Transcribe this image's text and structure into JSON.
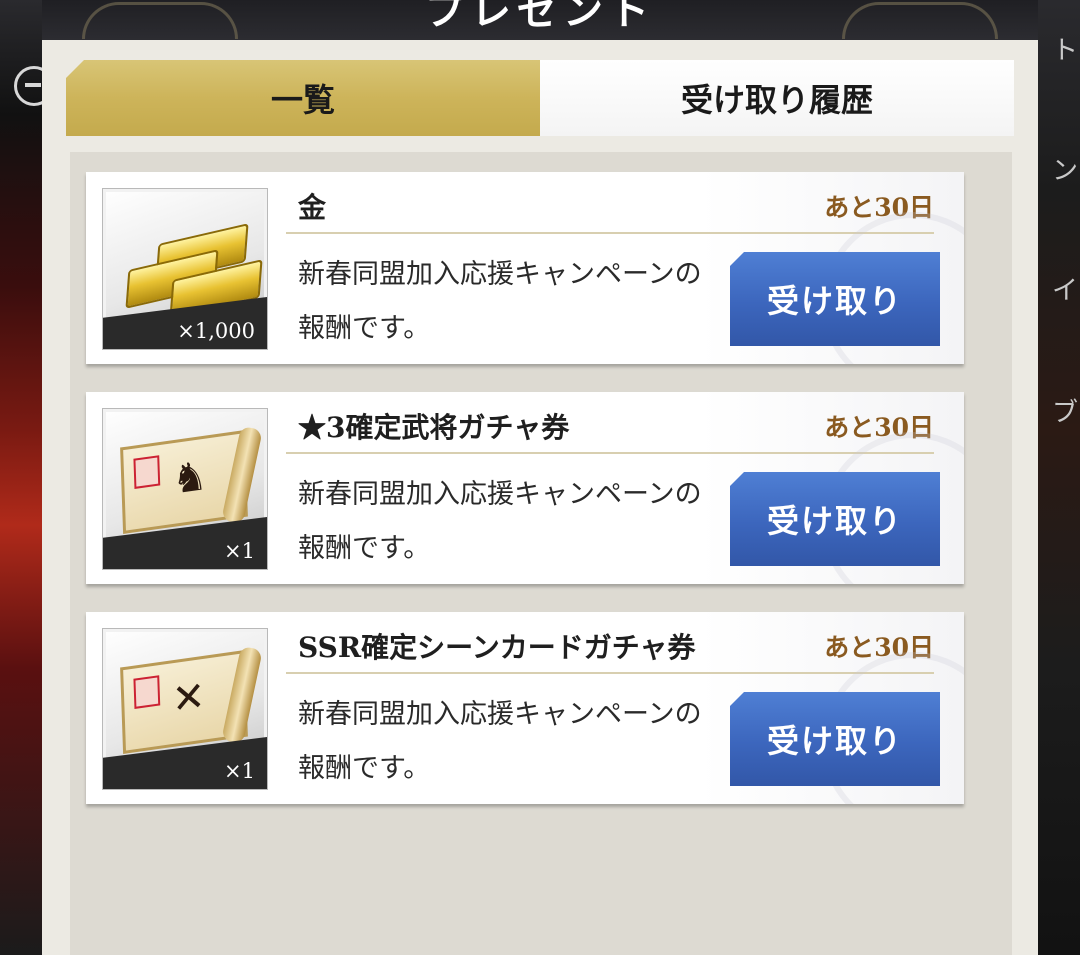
{
  "header": {
    "title": "プレゼント"
  },
  "side": {
    "label_1": "ト",
    "label_2": "ン",
    "label_3": "イ",
    "label_4": "ブ"
  },
  "tabs": [
    {
      "label": "一覧",
      "active": true
    },
    {
      "label": "受け取り履歴",
      "active": false
    }
  ],
  "items": [
    {
      "name": "金",
      "remaining": "あと30日",
      "description": "新春同盟加入応援キャンペーンの報酬です。",
      "quantity": "×1,000",
      "icon": "gold-bars-icon",
      "button": "受け取り"
    },
    {
      "name": "★3確定武将ガチャ券",
      "remaining": "あと30日",
      "description": "新春同盟加入応援キャンペーンの報酬です。",
      "quantity": "×1",
      "icon": "general-gacha-ticket-icon",
      "button": "受け取り"
    },
    {
      "name": "SSR確定シーンカードガチャ券",
      "remaining": "あと30日",
      "description": "新春同盟加入応援キャンペーンの報酬です。",
      "quantity": "×1",
      "icon": "scene-card-gacha-ticket-icon",
      "button": "受け取り"
    }
  ],
  "colors": {
    "tab_active": "#cdb45a",
    "button_blue": "#3c66bd",
    "remaining_text": "#8a5a20"
  }
}
